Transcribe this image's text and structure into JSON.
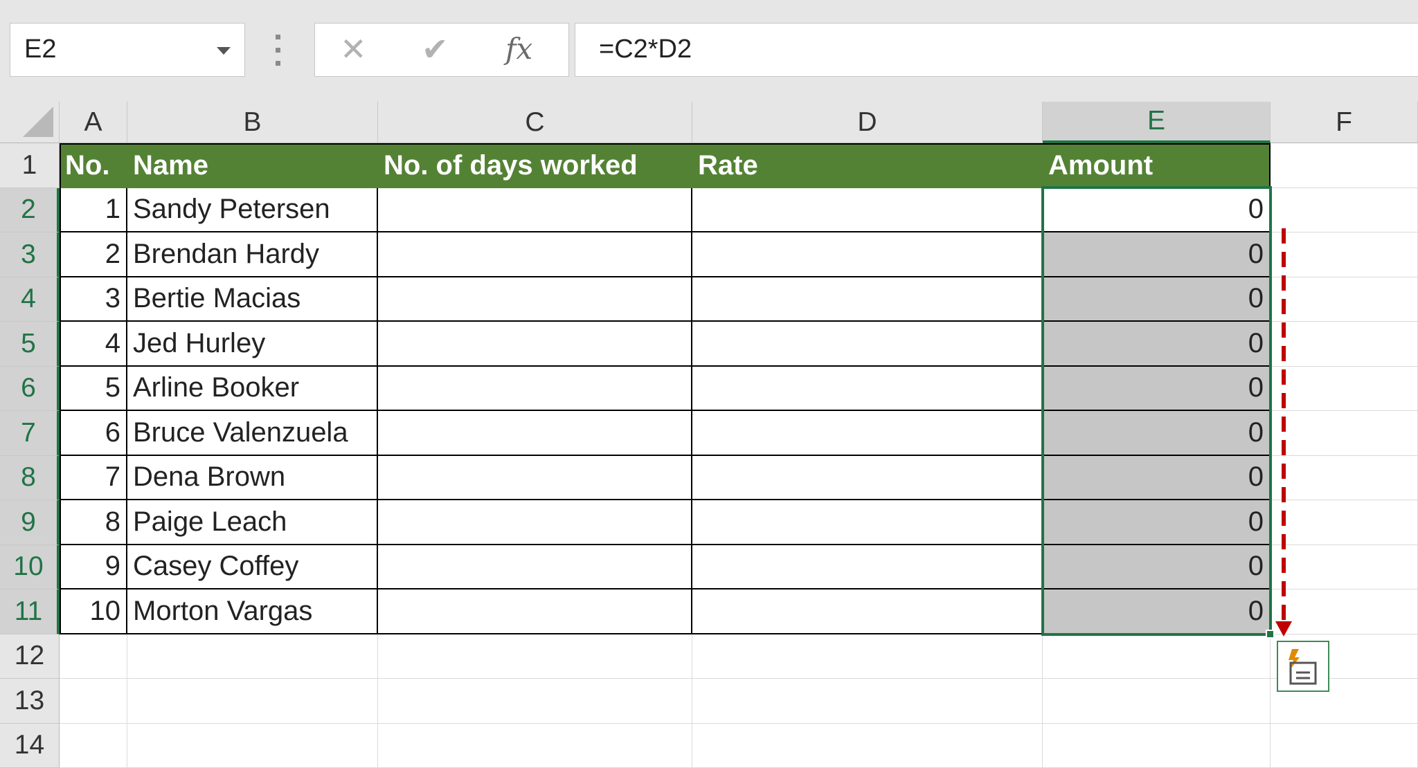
{
  "name_box": {
    "value": "E2",
    "dropdown_icon": "chevron-down-icon"
  },
  "formula_bar": {
    "cancel_icon": "x-icon",
    "enter_icon": "checkmark-icon",
    "fx_label": "fx",
    "formula": "=C2*D2"
  },
  "columns": [
    "A",
    "B",
    "C",
    "D",
    "E",
    "F"
  ],
  "selected_column": "E",
  "rows": [
    "1",
    "2",
    "3",
    "4",
    "5",
    "6",
    "7",
    "8",
    "9",
    "10",
    "11",
    "12",
    "13",
    "14"
  ],
  "selected_rows": [
    "2",
    "3",
    "4",
    "5",
    "6",
    "7",
    "8",
    "9",
    "10",
    "11"
  ],
  "table": {
    "headers": [
      "No.",
      "Name",
      "No. of days worked",
      "Rate",
      "Amount"
    ],
    "header_color": "#548235",
    "records": [
      {
        "no": "1",
        "name": "Sandy Petersen",
        "days": "",
        "rate": "",
        "amount": "0"
      },
      {
        "no": "2",
        "name": "Brendan Hardy",
        "days": "",
        "rate": "",
        "amount": "0"
      },
      {
        "no": "3",
        "name": "Bertie Macias",
        "days": "",
        "rate": "",
        "amount": "0"
      },
      {
        "no": "4",
        "name": "Jed Hurley",
        "days": "",
        "rate": "",
        "amount": "0"
      },
      {
        "no": "5",
        "name": "Arline Booker",
        "days": "",
        "rate": "",
        "amount": "0"
      },
      {
        "no": "6",
        "name": "Bruce Valenzuela",
        "days": "",
        "rate": "",
        "amount": "0"
      },
      {
        "no": "7",
        "name": "Dena Brown",
        "days": "",
        "rate": "",
        "amount": "0"
      },
      {
        "no": "8",
        "name": "Paige Leach",
        "days": "",
        "rate": "",
        "amount": "0"
      },
      {
        "no": "9",
        "name": "Casey Coffey",
        "days": "",
        "rate": "",
        "amount": "0"
      },
      {
        "no": "10",
        "name": "Morton Vargas",
        "days": "",
        "rate": "",
        "amount": "0"
      }
    ]
  },
  "selection_color": "#217346",
  "fill_drag_arrow": {
    "icon": "dashed-arrow-down-icon",
    "color": "#c00000"
  },
  "quick_analysis": {
    "icon": "quick-analysis-icon"
  }
}
